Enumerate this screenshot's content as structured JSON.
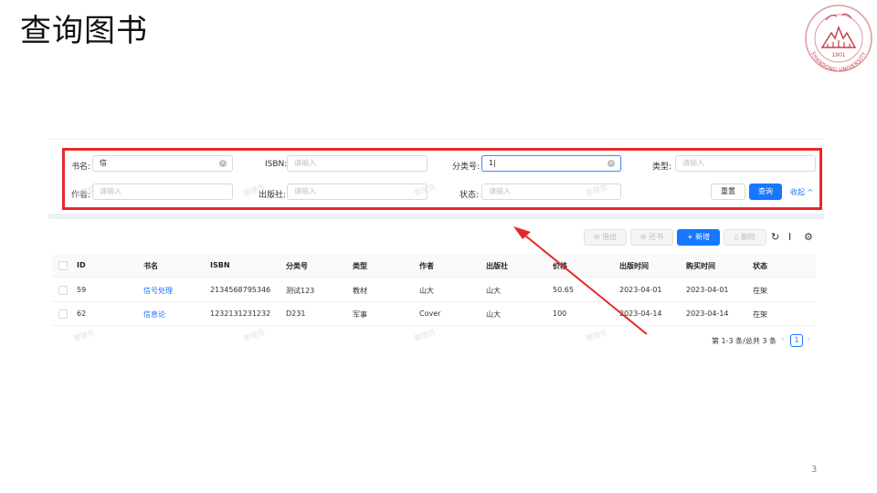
{
  "slide": {
    "title": "查询图书",
    "page_number": "3"
  },
  "logo": {
    "year": "1901",
    "university": "SHANDONG UNIVERSITY",
    "accent": "#c8404a"
  },
  "search_form": {
    "fields": [
      {
        "label": "书名:",
        "value": "信",
        "placeholder": ""
      },
      {
        "label": "ISBN:",
        "value": "",
        "placeholder": "请输入"
      },
      {
        "label": "分类号:",
        "value": "1",
        "placeholder": ""
      },
      {
        "label": "类型:",
        "value": "",
        "placeholder": "请输入"
      },
      {
        "label": "作者:",
        "value": "",
        "placeholder": "请输入"
      },
      {
        "label": "出版社:",
        "value": "",
        "placeholder": "请输入"
      },
      {
        "label": "状态:",
        "value": "",
        "placeholder": "请输入"
      }
    ],
    "reset_label": "重置",
    "query_label": "查询",
    "collapse_label": "收起"
  },
  "toolbar": {
    "borrow_label": "借出",
    "return_label": "还书",
    "add_label": "新增",
    "delete_label": "删除"
  },
  "table": {
    "columns": [
      "ID",
      "书名",
      "ISBN",
      "分类号",
      "类型",
      "作者",
      "出版社",
      "价格",
      "出版时间",
      "购买时间",
      "状态"
    ],
    "rows": [
      [
        "59",
        "信号处理",
        "2134568795346",
        "测试123",
        "教材",
        "山大",
        "山大",
        "50.65",
        "2023-04-01",
        "2023-04-01",
        "在架"
      ],
      [
        "62",
        "信息论",
        "1232131231232",
        "D231",
        "军事",
        "Cover",
        "山大",
        "100",
        "2023-04-14",
        "2023-04-14",
        "在架"
      ]
    ]
  },
  "pagination": {
    "summary": "第 1-3 条/总共 3 条",
    "current_page": "1"
  },
  "watermark": "管理员",
  "colors": {
    "primary": "#1677ff",
    "highlight": "#e8272b"
  }
}
